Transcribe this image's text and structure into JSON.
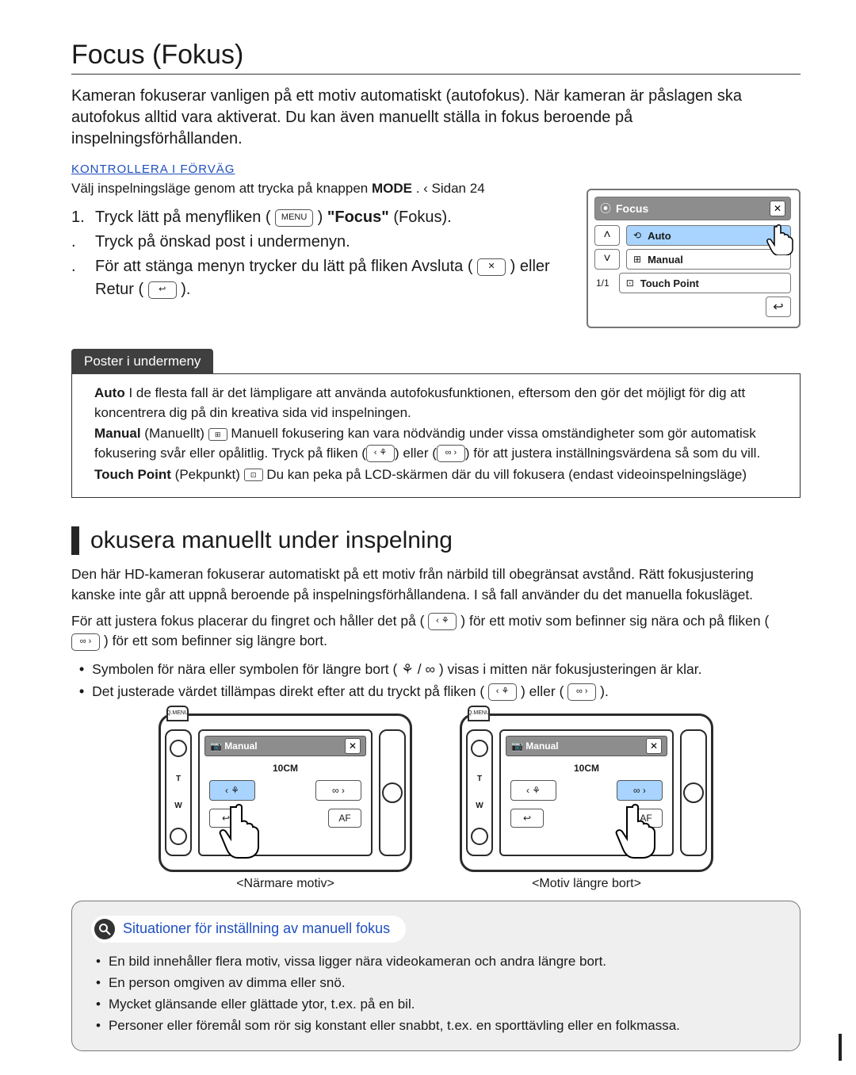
{
  "section1": {
    "title": "Focus (Fokus)",
    "intro": "Kameran fokuserar vanligen på ett motiv automatiskt (autofokus). När kameran är påslagen ska autofokus alltid vara aktiverat. Du kan även manuellt ställa in fokus beroende på inspelningsförhållanden.",
    "check_ahead": "KONTROLLERA I FÖRVÄG",
    "pre_step": {
      "before": "Välj inspelningsläge genom att trycka på knappen ",
      "mode_label": "MODE",
      "after": ".  ‹ Sidan 24"
    },
    "steps": [
      {
        "n": "1.",
        "before": "Tryck lätt på menyfliken (",
        "chip": "MENU",
        "mid": ")     ",
        "q": "\"Focus\"",
        "after": " (Fokus)."
      },
      {
        "n": ".",
        "text": "Tryck på önskad post i undermenyn."
      },
      {
        "n": ".",
        "before": "För att stänga menyn trycker du lätt på fliken Avsluta (",
        "chip1": "✕",
        "mid": ") eller Retur (",
        "chip2": "↩",
        "after": ")."
      }
    ],
    "lcd": {
      "title_icon": "⦿",
      "title": "Focus",
      "items": [
        {
          "icon": "⟲",
          "label": "Auto",
          "selected": true
        },
        {
          "icon": "⊞",
          "label": "Manual",
          "selected": false
        },
        {
          "icon": "⊡",
          "label": "Touch Point",
          "selected": false
        }
      ],
      "page": "1/1"
    },
    "submenu_label": "Poster i undermeny",
    "submenu": [
      {
        "name": "Auto",
        "after": " I de flesta fall är det lämpligare att använda autofokusfunktionen, eftersom den gör det möjligt för dig att koncentrera dig på din kreativa sida vid inspelningen."
      },
      {
        "name": "Manual",
        "paren": " (Manuellt) ",
        "before": " Manuell fokusering kan vara nödvändig under vissa omständigheter som gör automatisk fokusering svår eller opålitlig. Tryck på fliken (",
        "chipL": "‹ ⚘",
        "mid": ") eller (",
        "chipR": "∞ ›",
        "after": ") för att justera inställningsvärdena så som du vill."
      },
      {
        "name": "Touch Point",
        "paren": " (Pekpunkt) ",
        "after": "  Du kan peka på LCD-skärmen där du vill fokusera (endast videoinspelningsläge)"
      }
    ]
  },
  "section2": {
    "title": "okusera manuellt under inspelning",
    "p1": "Den här HD-kameran fokuserar automatiskt på ett motiv från närbild till obegränsat avstånd. Rätt fokusjustering kanske inte går att uppnå  beroende på inspelningsförhållandena. I så fall  använder du det manuella fokusläget.",
    "p2a": "För att justera fokus placerar du fingret och håller det på (",
    "p2_chip1": "‹ ⚘",
    "p2b": ") för ett motiv som befinner sig nära och på fliken (",
    "p2_chip2": "∞ ›",
    "p2c": ") för ett som befinner sig längre bort.",
    "b1a": "Symbolen för nära eller symbolen för längre bort ( ",
    "b1_sym": "⚘ / ∞",
    "b1b": " ) visas i mitten när fokusjusteringen är klar.",
    "b2a": "Det justerade värdet tillämpas direkt efter att du tryckt på fliken (",
    "b2_chip1": "‹ ⚘",
    "b2b": ") eller (",
    "b2_chip2": "∞ ›",
    "b2c": ").",
    "cam_screen": {
      "title_icon": "📷",
      "title": "Manual",
      "distance": "10CM",
      "btn_near": "‹ ⚘",
      "btn_far": "∞ ›",
      "btn_return": "↩",
      "btn_af": "AF",
      "bump": "Q.MENU",
      "side_t": "T",
      "side_w": "W"
    },
    "captions": [
      "<Närmare motiv>",
      "<Motiv längre bort>"
    ],
    "situations_title": "Situationer för inställning av manuell fokus",
    "situations": [
      "En bild innehåller flera motiv, vissa ligger nära videokameran och andra längre bort.",
      "En person omgiven av dimma eller snö.",
      "Mycket glänsande eller glättade ytor, t.ex. på en bil.",
      "Personer eller föremål som rör sig konstant eller snabbt, t.ex. en sporttävling eller en folkmassa."
    ]
  }
}
